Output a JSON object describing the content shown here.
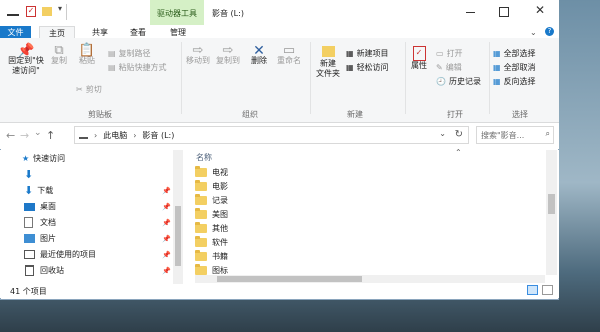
{
  "window": {
    "title_context_tab": "驱动器工具",
    "title": "影音 (L:)",
    "qat_dropdown": "▾"
  },
  "tabs": [
    "文件",
    "主页",
    "共享",
    "查看",
    "管理"
  ],
  "ribbon": {
    "clipboard": {
      "pin_label": "固定到\"快\n速访问\"",
      "copy": "复制",
      "paste": "粘贴",
      "copy_path": "复制路径",
      "paste_shortcut": "粘贴快捷方式",
      "cut": "剪切",
      "group": "剪贴板"
    },
    "organize": {
      "move_to": "移动到",
      "copy_to": "复制到",
      "delete": "删除",
      "rename": "重命名",
      "group": "组织"
    },
    "new": {
      "new_folder": "新建\n文件夹",
      "new_item": "新建项目",
      "easy_access": "轻松访问",
      "group": "新建"
    },
    "open": {
      "properties": "属性",
      "open": "打开",
      "edit": "编辑",
      "history": "历史记录",
      "group": "打开"
    },
    "select": {
      "select_all": "全部选择",
      "select_none": "全部取消",
      "invert": "反向选择",
      "group": "选择"
    }
  },
  "address": {
    "sep1": "›",
    "crumb1": "此电脑",
    "sep2": "›",
    "crumb2": "影音 (L:)",
    "dropdown": "⌄",
    "search_placeholder": "搜索\"影音...",
    "back": "←",
    "forward": "→",
    "recent": "⌄",
    "up": "↑",
    "refresh": "↻"
  },
  "nav": [
    {
      "label": "快速访问",
      "icon": "star-icon"
    },
    {
      "label": "",
      "icon": "download-arrow-icon"
    },
    {
      "label": "下载",
      "icon": "download-icon"
    },
    {
      "label": "桌面",
      "icon": "desktop-icon"
    },
    {
      "label": "文档",
      "icon": "documents-icon"
    },
    {
      "label": "图片",
      "icon": "pictures-icon"
    },
    {
      "label": "最近使用的项目",
      "icon": "recent-icon"
    },
    {
      "label": "回收站",
      "icon": "recycle-bin-icon"
    }
  ],
  "list": {
    "header": "名称",
    "files": [
      "电视",
      "电影",
      "记录",
      "美图",
      "其他",
      "软件",
      "书籍",
      "图标"
    ]
  },
  "status": {
    "count": "41 个项目"
  },
  "colors": {
    "accent": "#1979ca",
    "drive_tools_green": "#d5f0c6"
  }
}
